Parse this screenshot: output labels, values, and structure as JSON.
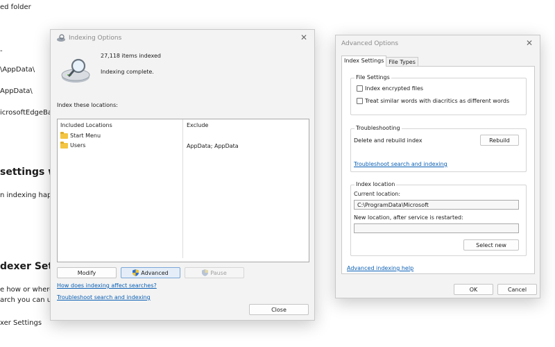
{
  "background": {
    "lines": [
      "ed folder",
      "\\AppData\\",
      "AppData\\",
      "icrosoftEdgeBa",
      "settings wh",
      "n indexing happ",
      "dexer Settin",
      "e how or where",
      "arch you can us",
      "xer Settings"
    ]
  },
  "indexing": {
    "title": "Indexing Options",
    "close_glyph": "✕",
    "items_indexed": "27,118 items indexed",
    "status": "Indexing complete.",
    "locations_label": "Index these locations:",
    "col_included": "Included Locations",
    "col_exclude": "Exclude",
    "rows": [
      {
        "name": "Start Menu",
        "exclude": ""
      },
      {
        "name": "Users",
        "exclude": "AppData; AppData"
      }
    ],
    "btn_modify": "Modify",
    "btn_advanced": "Advanced",
    "btn_pause": "Pause",
    "link_affect": "How does indexing affect searches?",
    "link_troubleshoot": "Troubleshoot search and indexing",
    "btn_close": "Close"
  },
  "advanced": {
    "title": "Advanced Options",
    "close_glyph": "✕",
    "tab_index_settings": "Index Settings",
    "tab_file_types": "File Types",
    "file_settings_title": "File Settings",
    "chk_encrypted": "Index encrypted files",
    "chk_diacritics": "Treat similar words with diacritics as different words",
    "troubleshooting_title": "Troubleshooting",
    "delete_rebuild_label": "Delete and rebuild index",
    "btn_rebuild": "Rebuild",
    "link_troubleshoot": "Troubleshoot search and indexing",
    "index_location_title": "Index location",
    "current_location_label": "Current location:",
    "current_location_value": "C:\\ProgramData\\Microsoft",
    "new_location_label": "New location, after service is restarted:",
    "new_location_value": "",
    "btn_select_new": "Select new",
    "link_advanced_help": "Advanced indexing help",
    "btn_ok": "OK",
    "btn_cancel": "Cancel"
  },
  "colors": {
    "link": "#0a5fb4",
    "folder": "#f4c542",
    "window_bg": "#f3f3f3"
  }
}
